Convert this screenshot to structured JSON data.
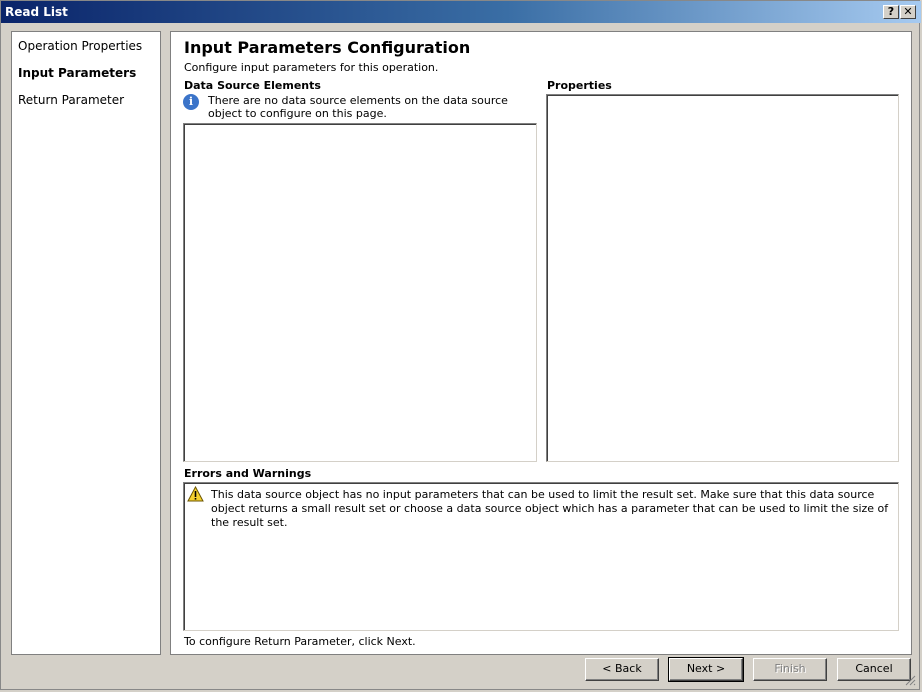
{
  "window": {
    "title": "Read List",
    "help_label": "?",
    "close_label": "✕"
  },
  "nav": {
    "items": [
      {
        "label": "Operation Properties",
        "active": false
      },
      {
        "label": "Input Parameters",
        "active": true
      },
      {
        "label": "Return Parameter",
        "active": false
      }
    ]
  },
  "content": {
    "title": "Input Parameters Configuration",
    "subtitle": "Configure input parameters for this operation.",
    "data_source": {
      "label": "Data Source Elements",
      "info_icon": "i",
      "info_text": "There are no data source elements on the data source object to configure on this page."
    },
    "properties": {
      "label": "Properties"
    },
    "errors": {
      "label": "Errors and Warnings",
      "warning_text": "This data source object has no input parameters that can be used to limit the result set. Make sure that this data source object returns a small result set or choose a data source object which has a parameter that can be used to limit the size of the result set."
    },
    "footer_hint": "To configure Return Parameter, click Next."
  },
  "buttons": {
    "back": "< Back",
    "next": "Next >",
    "finish": "Finish",
    "cancel": "Cancel"
  },
  "icons": {
    "info": "info-icon",
    "warning": "warning-icon",
    "help": "help-icon",
    "close": "close-icon",
    "resize": "resize-grip-icon"
  },
  "colors": {
    "titlebar_start": "#0a246a",
    "titlebar_end": "#a6caf0",
    "info_blue": "#3b74c9",
    "warning_yellow": "#f5d130"
  }
}
